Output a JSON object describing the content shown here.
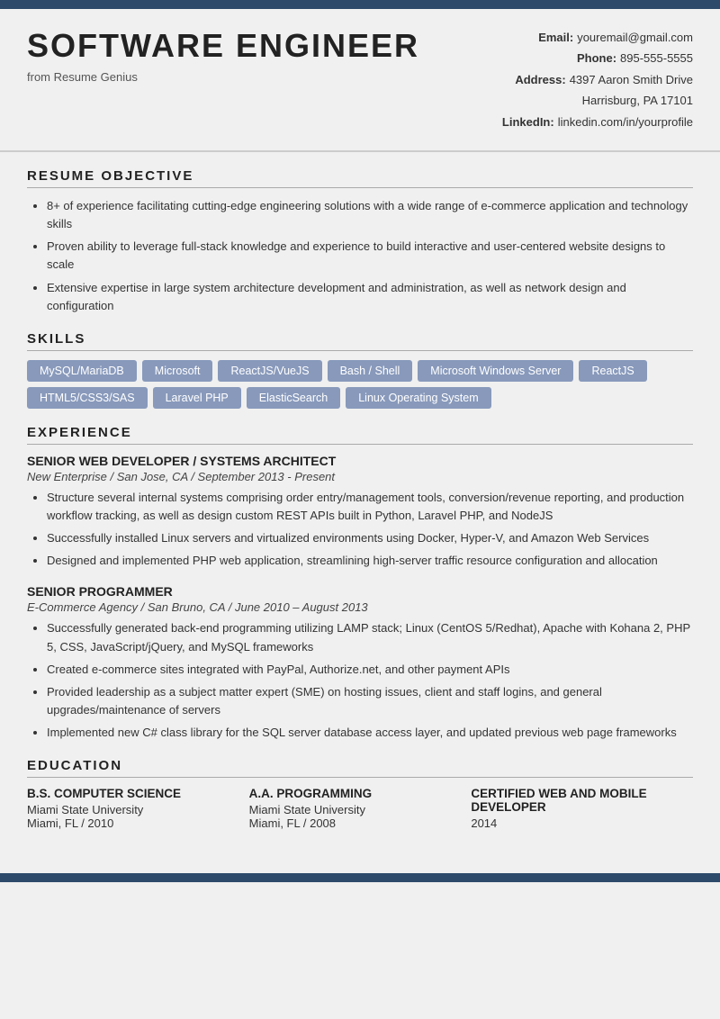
{
  "topbar": {},
  "header": {
    "name": "SOFTWARE ENGINEER",
    "subtitle": "from Resume Genius",
    "contact": {
      "email_label": "Email:",
      "email_value": "youremail@gmail.com",
      "phone_label": "Phone:",
      "phone_value": "895-555-5555",
      "address_label": "Address:",
      "address_value": "4397 Aaron Smith Drive",
      "address_value2": "Harrisburg, PA 17101",
      "linkedin_label": "LinkedIn:",
      "linkedin_value": "linkedin.com/in/yourprofile"
    }
  },
  "sections": {
    "objective": {
      "title": "RESUME OBJECTIVE",
      "bullets": [
        "8+ of experience facilitating cutting-edge engineering solutions with a wide range of e-commerce application and technology skills",
        "Proven ability to leverage full-stack knowledge and experience to build interactive and user-centered website designs to scale",
        "Extensive expertise in large system architecture development and administration, as well as network design and configuration"
      ]
    },
    "skills": {
      "title": "SKILLS",
      "tags": [
        "MySQL/MariaDB",
        "Microsoft",
        "ReactJS/VueJS",
        "Bash / Shell",
        "Microsoft Windows Server",
        "ReactJS",
        "HTML5/CSS3/SAS",
        "Laravel PHP",
        "ElasticSearch",
        "Linux Operating System"
      ]
    },
    "experience": {
      "title": "EXPERIENCE",
      "jobs": [
        {
          "title": "SENIOR WEB DEVELOPER / SYSTEMS ARCHITECT",
          "meta": "New Enterprise / San Jose, CA / September 2013 - Present",
          "bullets": [
            "Structure several internal systems comprising order entry/management tools, conversion/revenue reporting, and production workflow tracking, as well as design custom REST APIs built in Python, Laravel PHP, and NodeJS",
            "Successfully installed Linux servers and virtualized environments using Docker, Hyper-V, and Amazon Web Services",
            "Designed and implemented PHP web application, streamlining high-server traffic resource configuration and allocation"
          ]
        },
        {
          "title": "SENIOR PROGRAMMER",
          "meta": "E-Commerce Agency / San Bruno, CA / June 2010 – August 2013",
          "bullets": [
            "Successfully generated back-end programming utilizing LAMP stack; Linux (CentOS 5/Redhat), Apache with Kohana 2, PHP 5, CSS, JavaScript/jQuery, and MySQL frameworks",
            "Created e-commerce sites integrated with PayPal, Authorize.net, and other payment APIs",
            "Provided leadership as a subject matter expert (SME) on hosting issues, client and staff logins, and general upgrades/maintenance of servers",
            "Implemented new C# class library for the SQL server database access layer, and updated previous web page frameworks"
          ]
        }
      ]
    },
    "education": {
      "title": "EDUCATION",
      "degrees": [
        {
          "degree": "B.S. COMPUTER SCIENCE",
          "school": "Miami State University",
          "detail": "Miami, FL / 2010"
        },
        {
          "degree": "A.A. PROGRAMMING",
          "school": "Miami State University",
          "detail": "Miami, FL / 2008"
        },
        {
          "degree": "CERTIFIED WEB AND MOBILE DEVELOPER",
          "school": "",
          "detail": "2014"
        }
      ]
    }
  }
}
